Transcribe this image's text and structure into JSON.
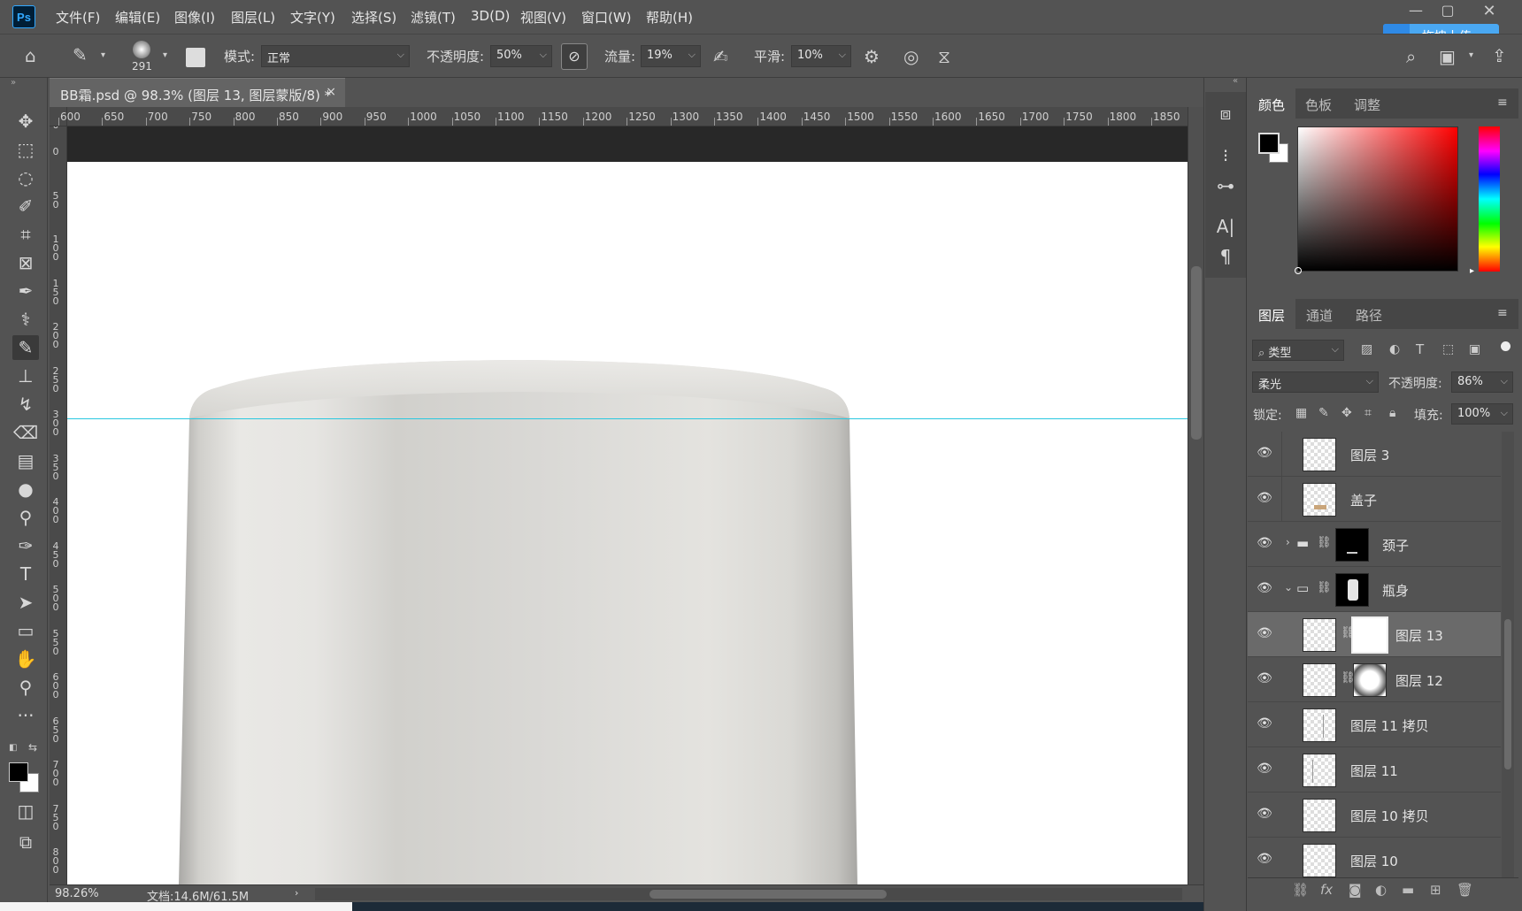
{
  "app": {
    "logo": "Ps"
  },
  "menu": [
    "文件(F)",
    "编辑(E)",
    "图像(I)",
    "图层(L)",
    "文字(Y)",
    "选择(S)",
    "滤镜(T)",
    "3D(D)",
    "视图(V)",
    "窗口(W)",
    "帮助(H)"
  ],
  "upload_button": "拖拽上传",
  "options": {
    "brush_size": "291",
    "mode_label": "模式:",
    "mode_value": "正常",
    "opacity_label": "不透明度:",
    "opacity_value": "50%",
    "flow_label": "流量:",
    "flow_value": "19%",
    "smooth_label": "平滑:",
    "smooth_value": "10%"
  },
  "document": {
    "tab_title": "BB霜.psd @ 98.3% (图层 13, 图层蒙版/8) *",
    "close": "×"
  },
  "ruler": {
    "h_ticks": [
      "600",
      "650",
      "700",
      "750",
      "800",
      "850",
      "900",
      "950",
      "1000",
      "1050",
      "1100",
      "1150",
      "1200",
      "1250",
      "1300",
      "1350",
      "1400",
      "1450",
      "1500",
      "1550",
      "1600",
      "1650",
      "1700",
      "1750",
      "1800",
      "1850"
    ],
    "v_ticks": [
      "0",
      "0",
      "50",
      "100",
      "150",
      "200",
      "250",
      "300",
      "350",
      "400",
      "450",
      "500",
      "550",
      "600",
      "650",
      "700",
      "750",
      "800"
    ]
  },
  "status": {
    "zoom": "98.26%",
    "doc_size": "文档:14.6M/61.5M"
  },
  "colors": {
    "accent": "#31a8ff",
    "guide": "#29c8e0",
    "fg": "#000000",
    "bg": "#ffffff",
    "bottle": "#dcdbd8"
  },
  "color_panel": {
    "tabs": [
      "颜色",
      "色板",
      "调整"
    ]
  },
  "layers_panel": {
    "tabs": [
      "图层",
      "通道",
      "路径"
    ],
    "filter_label": "类型",
    "blend_mode": "柔光",
    "opacity_label": "不透明度:",
    "opacity_value": "86%",
    "lock_label": "锁定:",
    "fill_label": "填充:",
    "fill_value": "100%",
    "layers": [
      {
        "name": "图层 3"
      },
      {
        "name": "盖子"
      },
      {
        "name": "颈子"
      },
      {
        "name": "瓶身"
      },
      {
        "name": "图层 13"
      },
      {
        "name": "图层 12"
      },
      {
        "name": "图层 11 拷贝"
      },
      {
        "name": "图层 11"
      },
      {
        "name": "图层 10 拷贝"
      },
      {
        "name": "图层 10"
      }
    ]
  }
}
